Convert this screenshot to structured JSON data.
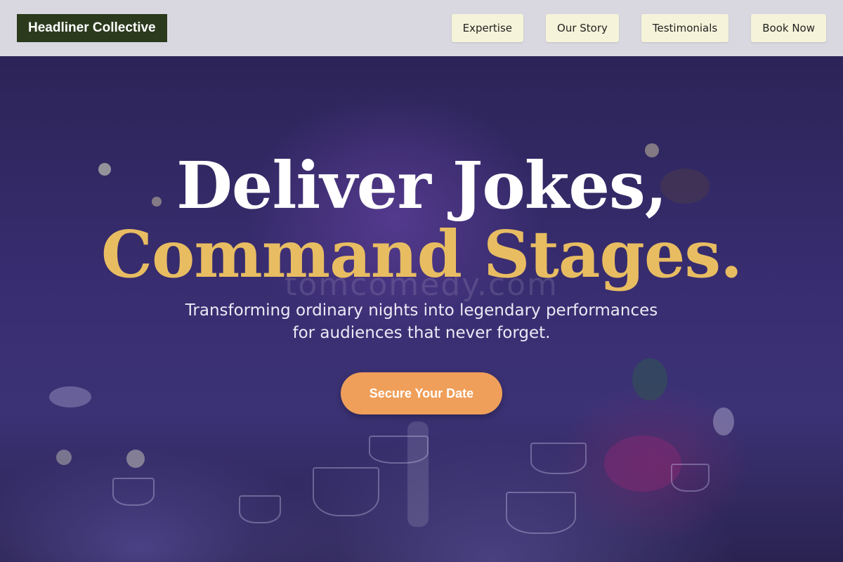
{
  "brand": {
    "name": "Headliner Collective"
  },
  "nav": {
    "items": [
      {
        "label": "Expertise"
      },
      {
        "label": "Our Story"
      },
      {
        "label": "Testimonials"
      },
      {
        "label": "Book Now"
      }
    ]
  },
  "hero": {
    "title_line1": "Deliver Jokes,",
    "title_line2": "Command Stages.",
    "watermark": "tomcomedy.com",
    "subtitle": "Transforming ordinary nights into legendary performances for audiences that never forget.",
    "cta_label": "Secure Your Date"
  },
  "colors": {
    "brand_bg": "#2b3a1d",
    "header_bg": "#d9d8e0",
    "nav_button_bg": "#f5f3d9",
    "accent_gold": "#e8bd62",
    "cta_bg": "#ef9f5a",
    "hero_bg": "#382d70"
  }
}
